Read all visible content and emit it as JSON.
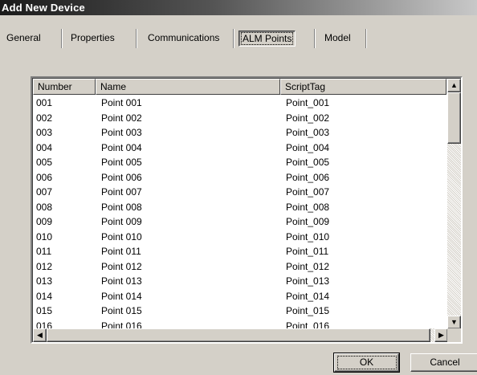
{
  "window": {
    "title": "Add New Device"
  },
  "tabs": [
    {
      "label": "General",
      "active": false
    },
    {
      "label": "Properties",
      "active": false
    },
    {
      "label": "Communications",
      "active": false
    },
    {
      "label": "ALM Points",
      "active": true
    },
    {
      "label": "Model",
      "active": false
    }
  ],
  "list": {
    "columns": [
      "Number",
      "Name",
      "ScriptTag"
    ],
    "rows": [
      [
        "001",
        "Point 001",
        "Point_001"
      ],
      [
        "002",
        "Point 002",
        "Point_002"
      ],
      [
        "003",
        "Point 003",
        "Point_003"
      ],
      [
        "004",
        "Point 004",
        "Point_004"
      ],
      [
        "005",
        "Point 005",
        "Point_005"
      ],
      [
        "006",
        "Point 006",
        "Point_006"
      ],
      [
        "007",
        "Point 007",
        "Point_007"
      ],
      [
        "008",
        "Point 008",
        "Point_008"
      ],
      [
        "009",
        "Point 009",
        "Point_009"
      ],
      [
        "010",
        "Point 010",
        "Point_010"
      ],
      [
        "011",
        "Point 011",
        "Point_011"
      ],
      [
        "012",
        "Point 012",
        "Point_012"
      ],
      [
        "013",
        "Point 013",
        "Point_013"
      ],
      [
        "014",
        "Point 014",
        "Point_014"
      ],
      [
        "015",
        "Point 015",
        "Point_015"
      ],
      [
        "016",
        "Point 016",
        "Point_016"
      ]
    ]
  },
  "buttons": {
    "ok": "OK",
    "cancel": "Cancel"
  },
  "icons": {
    "scroll_up": "triangle-up-icon",
    "scroll_down": "triangle-down-icon",
    "scroll_left": "triangle-left-icon",
    "scroll_right": "triangle-right-icon"
  }
}
